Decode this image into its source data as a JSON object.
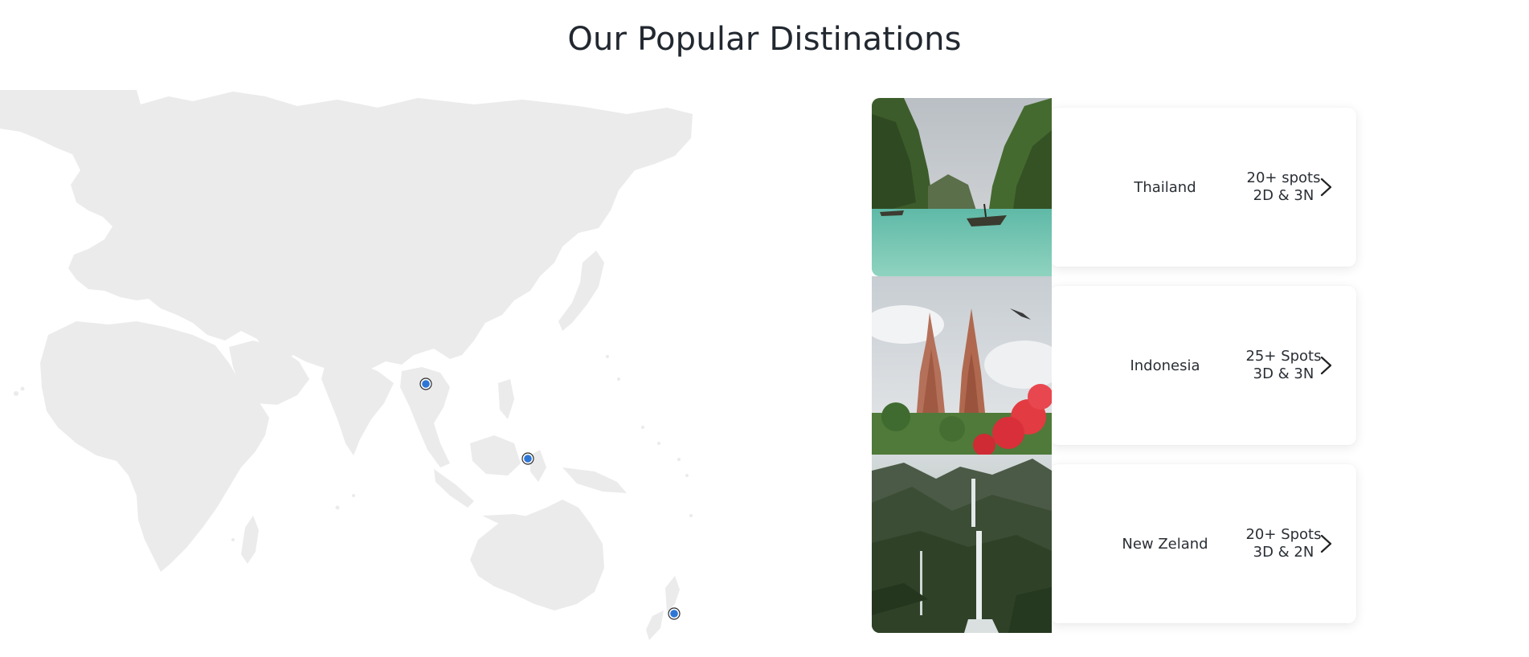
{
  "section": {
    "title": "Our Popular Distinations"
  },
  "map": {
    "markers": [
      {
        "name": "Thailand"
      },
      {
        "name": "Indonesia"
      },
      {
        "name": "New Zeland"
      }
    ],
    "colors": {
      "land": "#ebebeb",
      "marker": "#2e76d6"
    }
  },
  "destinations": [
    {
      "name": "Thailand",
      "spots": "20+ spots",
      "duration": "2D & 3N",
      "icon": "chevron-right-icon"
    },
    {
      "name": "Indonesia",
      "spots": "25+ Spots",
      "duration": "3D & 3N",
      "icon": "chevron-right-icon"
    },
    {
      "name": "New Zeland",
      "spots": "20+ Spots",
      "duration": "3D & 2N",
      "icon": "chevron-right-icon"
    }
  ]
}
